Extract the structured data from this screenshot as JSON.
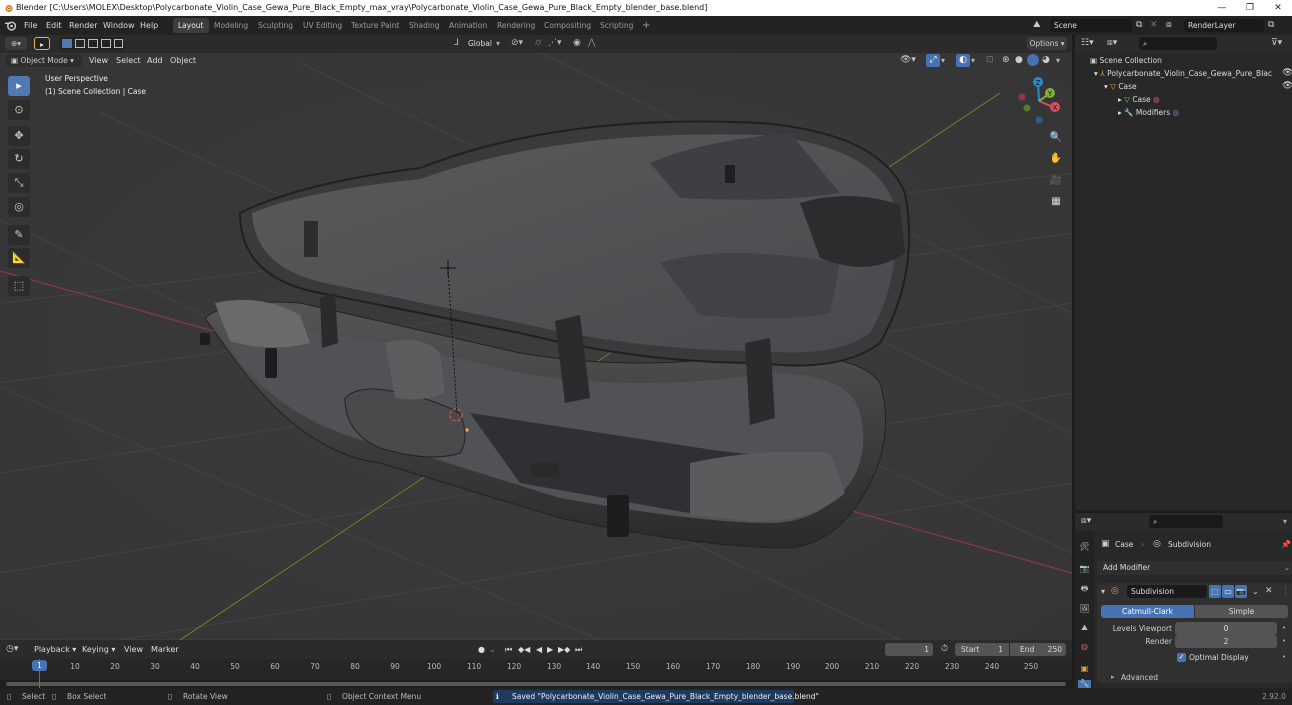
{
  "window": {
    "title": "Blender [C:\\Users\\MOLEX\\Desktop\\Polycarbonate_Violin_Case_Gewa_Pure_Black_Empty_max_vray\\Polycarbonate_Violin_Case_Gewa_Pure_Black_Empty_blender_base.blend]"
  },
  "menu": [
    "File",
    "Edit",
    "Render",
    "Window",
    "Help"
  ],
  "workspaces": [
    "Layout",
    "Modeling",
    "Sculpting",
    "UV Editing",
    "Texture Paint",
    "Shading",
    "Animation",
    "Rendering",
    "Compositing",
    "Scripting"
  ],
  "scene": {
    "name": "Scene",
    "view_layer": "RenderLayer"
  },
  "viewport": {
    "mode": "Object Mode",
    "menus": [
      "View",
      "Select",
      "Add",
      "Object"
    ],
    "orientation": "Global",
    "options_label": "Options",
    "overlay_line1": "User Perspective",
    "overlay_line2": "(1) Scene Collection | Case",
    "gizmo_axes": {
      "x": "X",
      "y": "Y",
      "z": "Z"
    }
  },
  "outliner": {
    "root": "Scene Collection",
    "items": [
      {
        "label": "Polycarbonate_Violin_Case_Gewa_Pure_Blac"
      },
      {
        "label": "Case"
      },
      {
        "label": "Case"
      },
      {
        "label": "Modifiers"
      }
    ]
  },
  "properties": {
    "breadcrumb_object": "Case",
    "breadcrumb_modifier": "Subdivision",
    "add_modifier": "Add Modifier",
    "modifier_name": "Subdivision",
    "tab_catmull": "Catmull-Clark",
    "tab_simple": "Simple",
    "levels_viewport_label": "Levels Viewport",
    "levels_viewport_value": "0",
    "render_label": "Render",
    "render_value": "2",
    "optimal_display": "Optimal Display",
    "advanced": "Advanced"
  },
  "timeline": {
    "menus": [
      "Playback",
      "Keying",
      "View",
      "Marker"
    ],
    "current_frame": "1",
    "start_label": "Start",
    "start_value": "1",
    "end_label": "End",
    "end_value": "250",
    "ticks": [
      "10",
      "20",
      "30",
      "40",
      "50",
      "60",
      "70",
      "80",
      "90",
      "100",
      "110",
      "120",
      "130",
      "140",
      "150",
      "160",
      "170",
      "180",
      "190",
      "200",
      "210",
      "220",
      "230",
      "240",
      "250"
    ],
    "playhead": "1"
  },
  "statusbar": {
    "select": "Select",
    "box_select": "Box Select",
    "rotate_view": "Rotate View",
    "context_menu": "Object Context Menu",
    "message": "Saved \"Polycarbonate_Violin_Case_Gewa_Pure_Black_Empty_blender_base.blend\"",
    "version": "2.92.0"
  },
  "colors": {
    "accent": "#4772b3",
    "viewport_bg": "#393939",
    "x_axis": "#dd4d5e",
    "y_axis": "#82ad3a",
    "z_axis": "#2c8ad6"
  }
}
